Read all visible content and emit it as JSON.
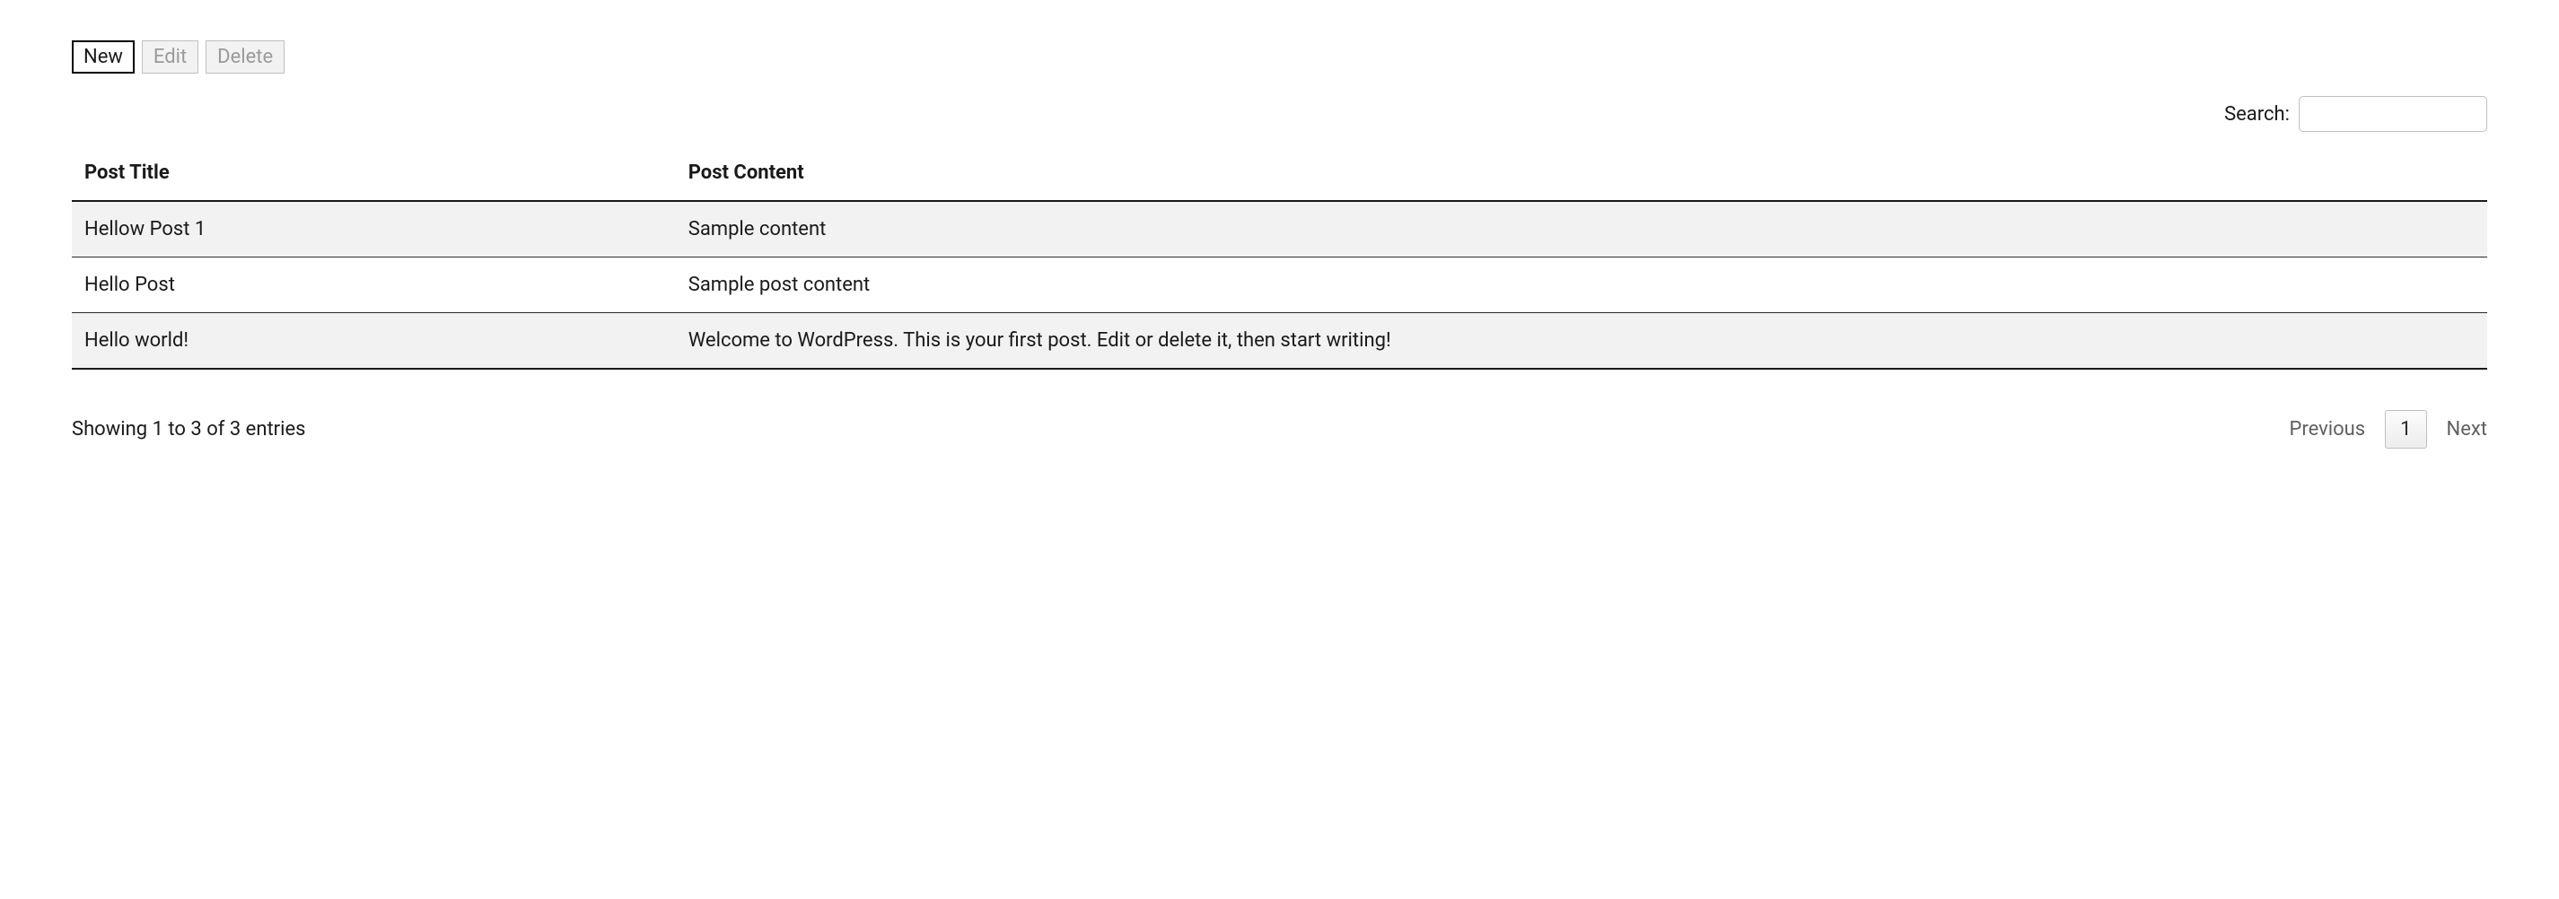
{
  "toolbar": {
    "new_label": "New",
    "edit_label": "Edit",
    "delete_label": "Delete"
  },
  "search": {
    "label": "Search:",
    "value": ""
  },
  "table": {
    "headers": {
      "title": "Post Title",
      "content": "Post Content"
    },
    "rows": [
      {
        "title": "Hellow Post 1",
        "content": "Sample content"
      },
      {
        "title": "Hello Post",
        "content": "Sample post content"
      },
      {
        "title": "Hello world!",
        "content": "Welcome to WordPress. This is your first post. Edit or delete it, then start writing!"
      }
    ]
  },
  "footer": {
    "info": "Showing 1 to 3 of 3 entries",
    "prev": "Previous",
    "next": "Next",
    "page": "1"
  }
}
